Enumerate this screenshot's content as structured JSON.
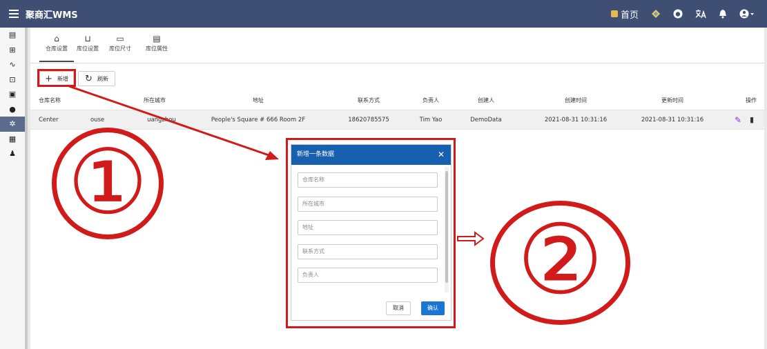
{
  "app": {
    "title": "聚商汇WMS"
  },
  "topbar": {
    "home_label": "首页"
  },
  "tabs": [
    {
      "label": "仓库设置",
      "icon": "warehouse-icon"
    },
    {
      "label": "库位设置",
      "icon": "shelf-icon"
    },
    {
      "label": "库位尺寸",
      "icon": "size-icon"
    },
    {
      "label": "库位属性",
      "icon": "property-icon"
    }
  ],
  "toolbar": {
    "add_label": "新增",
    "refresh_label": "刷新"
  },
  "table": {
    "headers": [
      "仓库名称",
      "所在城市",
      "地址",
      "联系方式",
      "负责人",
      "创建人",
      "创建时间",
      "更新时间",
      "操作"
    ],
    "rows": [
      {
        "name": "Center",
        "name_tail": "ouse",
        "city": "uangzhou",
        "address": "People's Square # 666 Room 2F",
        "contact": "18620785575",
        "manager": "Tim Yao",
        "creator": "DemoData",
        "created": "2021-08-31 10:31:16",
        "updated": "2021-08-31 10:31:16"
      }
    ]
  },
  "modal": {
    "title": "新增一条数据",
    "fields": [
      {
        "placeholder": "仓库名称"
      },
      {
        "placeholder": "所在城市"
      },
      {
        "placeholder": "地址"
      },
      {
        "placeholder": "联系方式"
      },
      {
        "placeholder": "负责人"
      }
    ],
    "cancel_label": "取消",
    "confirm_label": "确认"
  },
  "annotations": {
    "step1": "①",
    "step2": "②"
  },
  "colors": {
    "topbar": "#3f4f73",
    "modal_header": "#1760b0",
    "annotation_red": "#d11a1a",
    "sidebar_active": "#5b6b8c"
  }
}
